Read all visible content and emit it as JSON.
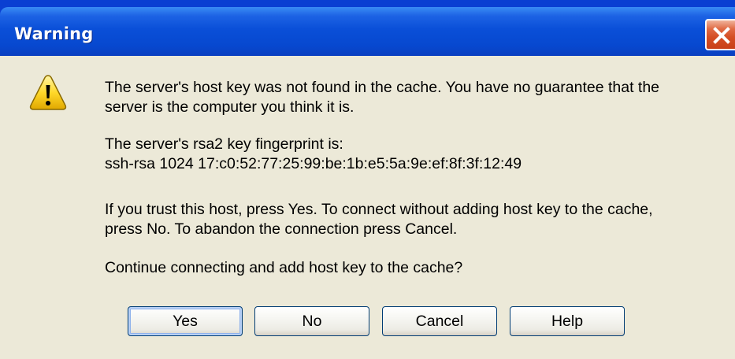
{
  "window": {
    "title": "Warning",
    "close_icon": "close-icon"
  },
  "dialog": {
    "icon": "warning-icon",
    "lines": [
      "The server's host key was not found in the cache. You have no guarantee that the",
      "server is the computer you think it is.",
      "The server's rsa2 key fingerprint is:",
      "ssh-rsa 1024 17:c0:52:77:25:99:be:1b:e5:5a:9e:ef:8f:3f:12:49",
      "If you trust this host, press Yes. To connect without adding host key to the cache,",
      "press No. To abandon the connection press Cancel.",
      "Continue connecting and add host key to the cache?"
    ]
  },
  "buttons": {
    "yes": "Yes",
    "no": "No",
    "cancel": "Cancel",
    "help": "Help"
  },
  "colors": {
    "titlebar": "#0a4fd8",
    "close": "#d44d23",
    "client": "#ece9d8",
    "button_border": "#003c74"
  }
}
